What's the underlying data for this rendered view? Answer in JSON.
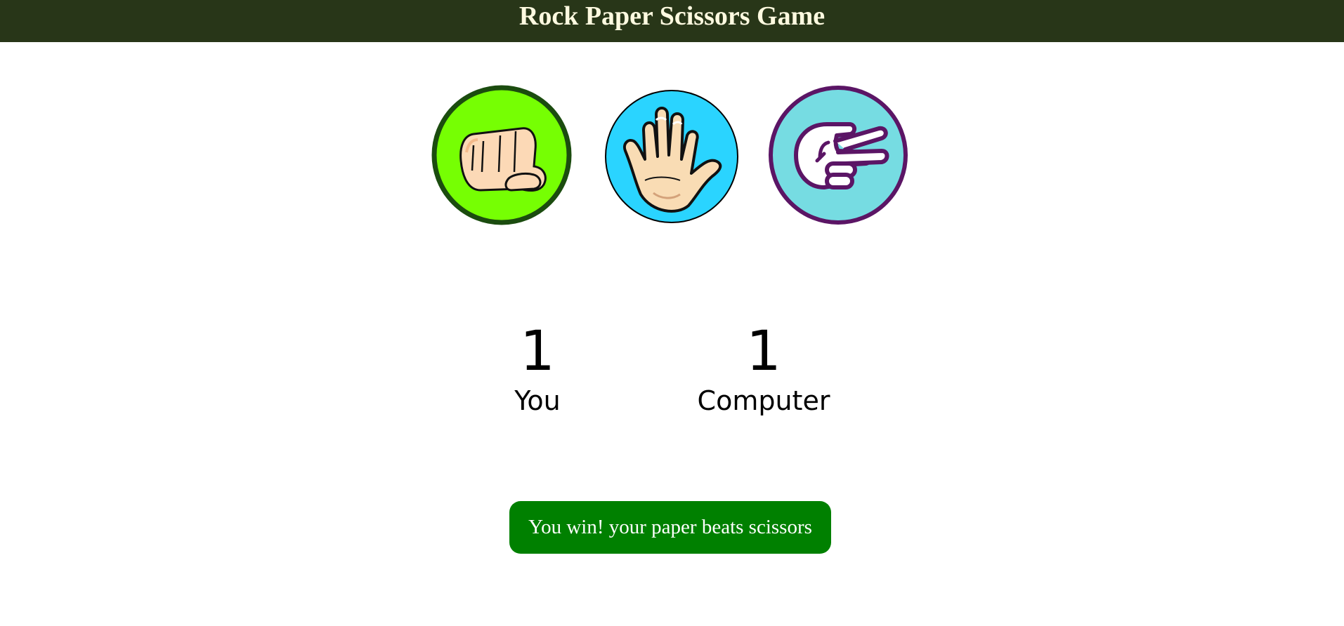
{
  "header": {
    "title": "Rock Paper Scissors Game"
  },
  "choices": [
    {
      "id": "rock",
      "icon": "fist-icon",
      "bg_color": "#76ff03",
      "border_color": "#1b4c0f"
    },
    {
      "id": "paper",
      "icon": "open-hand-icon",
      "bg_color": "#2ad4ff",
      "border_color": "#000000"
    },
    {
      "id": "scissors",
      "icon": "scissors-hand-icon",
      "bg_color": "#76dce2",
      "border_color": "#5b1565"
    }
  ],
  "scoreboard": {
    "user": {
      "score": "1",
      "label": "You"
    },
    "computer": {
      "score": "1",
      "label": "Computer"
    }
  },
  "message": {
    "text": "You win! your paper beats scissors",
    "bg_color": "#008000"
  },
  "colors": {
    "header_bg": "#283618",
    "header_text": "#fefae0"
  }
}
